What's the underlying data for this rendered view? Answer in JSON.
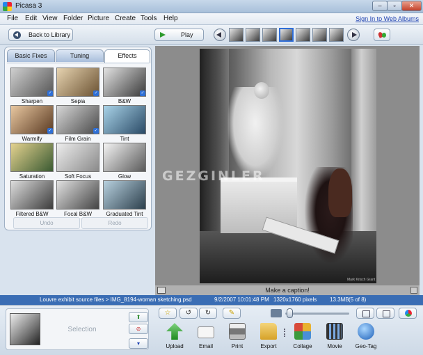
{
  "window": {
    "title": "Picasa 3",
    "min_label": "–",
    "max_label": "▫",
    "close_label": "✕"
  },
  "menu": {
    "items": [
      "File",
      "Edit",
      "View",
      "Folder",
      "Picture",
      "Create",
      "Tools",
      "Help"
    ],
    "sign_in": "Sign In to Web Albums"
  },
  "toolbar": {
    "back_label": "Back to Library",
    "play_label": "Play"
  },
  "tabs": [
    "Basic Fixes",
    "Tuning",
    "Effects"
  ],
  "effects": [
    {
      "name": "Sharpen",
      "badge": true,
      "colors": [
        "#cfcfcf",
        "#555555"
      ]
    },
    {
      "name": "Sepia",
      "badge": true,
      "colors": [
        "#e6d3b0",
        "#6b5232"
      ]
    },
    {
      "name": "B&W",
      "badge": true,
      "colors": [
        "#e2e2e2",
        "#3a3a3a"
      ]
    },
    {
      "name": "Warmify",
      "badge": true,
      "colors": [
        "#e8c7a0",
        "#5a3a22"
      ]
    },
    {
      "name": "Film Grain",
      "badge": true,
      "colors": [
        "#d6d6d6",
        "#4a4a4a"
      ]
    },
    {
      "name": "Tint",
      "badge": false,
      "colors": [
        "#a9d3e8",
        "#2a4a66"
      ]
    },
    {
      "name": "Saturation",
      "badge": false,
      "colors": [
        "#e4d28f",
        "#3a5a32"
      ]
    },
    {
      "name": "Soft Focus",
      "badge": false,
      "colors": [
        "#ededed",
        "#8a8a8a"
      ]
    },
    {
      "name": "Glow",
      "badge": false,
      "colors": [
        "#f4f4f4",
        "#5a5a5a"
      ]
    },
    {
      "name": "Filtered B&W",
      "badge": false,
      "colors": [
        "#dcdcdc",
        "#3c3c3c"
      ]
    },
    {
      "name": "Focal B&W",
      "badge": false,
      "colors": [
        "#e0e0e0",
        "#444444"
      ]
    },
    {
      "name": "Graduated Tint",
      "badge": false,
      "colors": [
        "#b7d0de",
        "#2c3f4c"
      ]
    }
  ],
  "panel": {
    "undo_label": "Undo",
    "redo_label": "Redo"
  },
  "photo": {
    "watermark": "GEZGINLER",
    "credit": "Mark Krisch Grant"
  },
  "caption": {
    "placeholder": "Make a caption!"
  },
  "info": {
    "path": "Louvre exhibit source files > IMG_8194-woman sketching.psd",
    "date": "9/2/2007 10:01:48 PM",
    "dimensions": "1320x1760 pixels",
    "size": "13.3MB",
    "count": "(5 of 8)"
  },
  "tray": {
    "selection_label": "Selection",
    "hold_glyph": "⬆",
    "clear_glyph": "⊘",
    "album_glyph": "▾"
  },
  "tools": {
    "star": "☆",
    "rotate_left": "↺",
    "rotate_right": "↻",
    "caption_tool": "✎"
  },
  "actions": [
    "Upload",
    "Email",
    "Print",
    "Export",
    "Collage",
    "Movie",
    "Geo-Tag"
  ]
}
